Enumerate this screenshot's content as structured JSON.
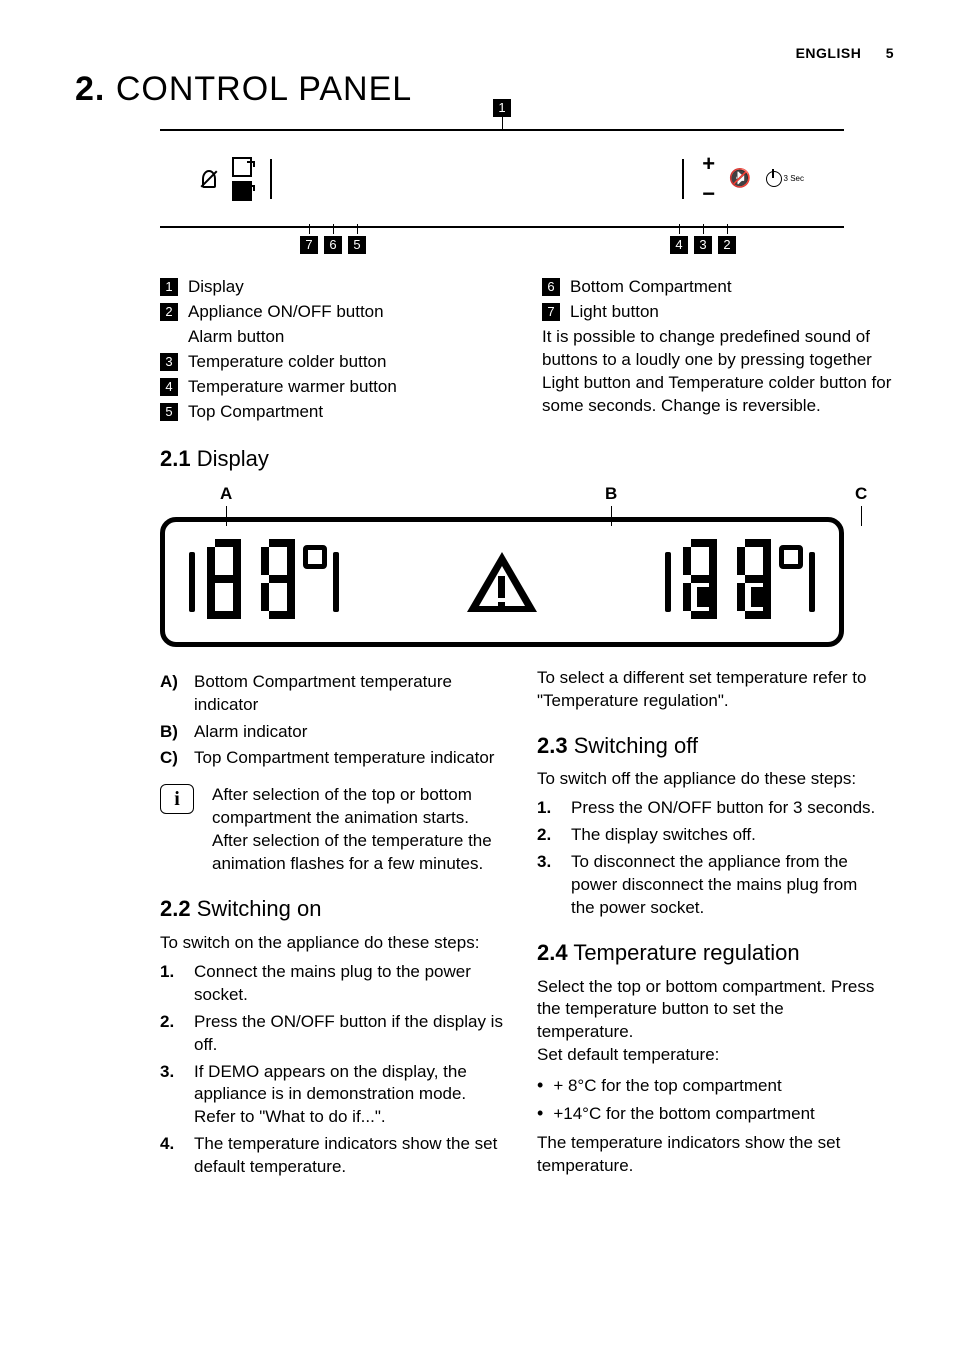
{
  "header": {
    "lang": "ENGLISH",
    "page": "5"
  },
  "title": {
    "num": "2.",
    "text": "CONTROL PANEL"
  },
  "fig1": {
    "topCallout": "1",
    "leftCallouts": [
      "7",
      "6",
      "5"
    ],
    "rightCallouts": [
      "4",
      "3",
      "2"
    ],
    "threeSec": "3 Sec"
  },
  "key": {
    "left": [
      {
        "n": "1",
        "t": "Display"
      },
      {
        "n": "2",
        "t": "Appliance ON/OFF button"
      },
      {
        "n": "",
        "t": "Alarm button"
      },
      {
        "n": "3",
        "t": "Temperature colder button"
      },
      {
        "n": "4",
        "t": "Temperature warmer button"
      },
      {
        "n": "5",
        "t": "Top Compartment"
      }
    ],
    "right": [
      {
        "n": "6",
        "t": "Bottom Compartment"
      },
      {
        "n": "7",
        "t": "Light button"
      }
    ],
    "note": "It is possible to change predefined sound of buttons to a loudly one by pressing together Light button and Temperature colder button for some seconds. Change is reversible."
  },
  "sec21": {
    "num": "2.1",
    "title": "Display",
    "labels": {
      "A": "A",
      "B": "B",
      "C": "C"
    },
    "items": [
      {
        "l": "A)",
        "t": "Bottom Compartment temperature indicator"
      },
      {
        "l": "B)",
        "t": "Alarm indicator"
      },
      {
        "l": "C)",
        "t": "Top Compartment temperature indicator"
      }
    ],
    "info": "After selection of the top or bottom compartment the animation  starts. After selection of the temperature the animation flashes for a few minutes."
  },
  "sec22": {
    "num": "2.2",
    "title": "Switching on",
    "intro": "To switch on the appliance do these steps:",
    "steps": [
      "Connect the mains plug to the power socket.",
      "Press the ON/OFF button if the display is off.",
      "If DEMO appears on the display, the appliance is in demonstration mode. Refer to \"What to do if...\".",
      "The temperature indicators show the set default temperature."
    ],
    "outro": "To select a different set temperature refer to \"Temperature regulation\"."
  },
  "sec23": {
    "num": "2.3",
    "title": "Switching off",
    "intro": "To switch off the appliance do these steps:",
    "steps": [
      "Press the ON/OFF button for 3 seconds.",
      "The display switches off.",
      "To disconnect the appliance from the power disconnect the mains plug from the power socket."
    ]
  },
  "sec24": {
    "num": "2.4",
    "title": "Temperature regulation",
    "p1": "Select the top or bottom compartment. Press the temperature button to set the temperature.",
    "p2": "Set default temperature:",
    "bullets": [
      "+ 8°C for the top compartment",
      "+14°C for the bottom compartment"
    ],
    "p3": "The temperature indicators show the set temperature."
  }
}
